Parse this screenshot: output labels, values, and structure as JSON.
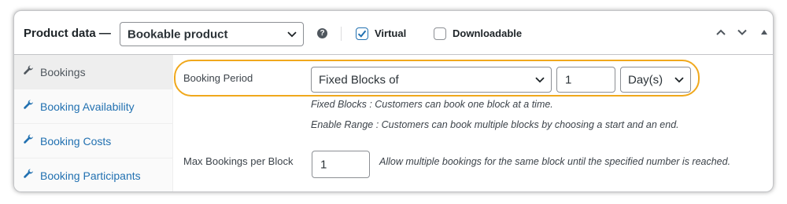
{
  "header": {
    "title": "Product data —",
    "product_type": "Bookable product",
    "help_glyph": "?",
    "virtual_label": "Virtual",
    "virtual_checked": true,
    "downloadable_label": "Downloadable",
    "downloadable_checked": false
  },
  "sidebar": {
    "items": [
      {
        "label": "Bookings",
        "icon": "wrench-icon",
        "active": true
      },
      {
        "label": "Booking Availability",
        "icon": "wrench-icon",
        "active": false
      },
      {
        "label": "Booking Costs",
        "icon": "wrench-icon",
        "active": false
      },
      {
        "label": "Booking Participants",
        "icon": "wrench-icon",
        "active": false
      }
    ]
  },
  "booking_period": {
    "label": "Booking Period",
    "type_value": "Fixed Blocks of",
    "quantity": "1",
    "unit": "Day(s)",
    "desc_fixed": "Fixed Blocks : Customers can book one block at a time.",
    "desc_range": "Enable Range : Customers can book multiple blocks by choosing a start and an end."
  },
  "max_bookings": {
    "label": "Max Bookings per Block",
    "value": "1",
    "help": "Allow multiple bookings for the same block until the specified number is reached."
  },
  "colors": {
    "link": "#2271b1",
    "highlight": "#f0a81c",
    "checkbox": "#2271b1"
  }
}
